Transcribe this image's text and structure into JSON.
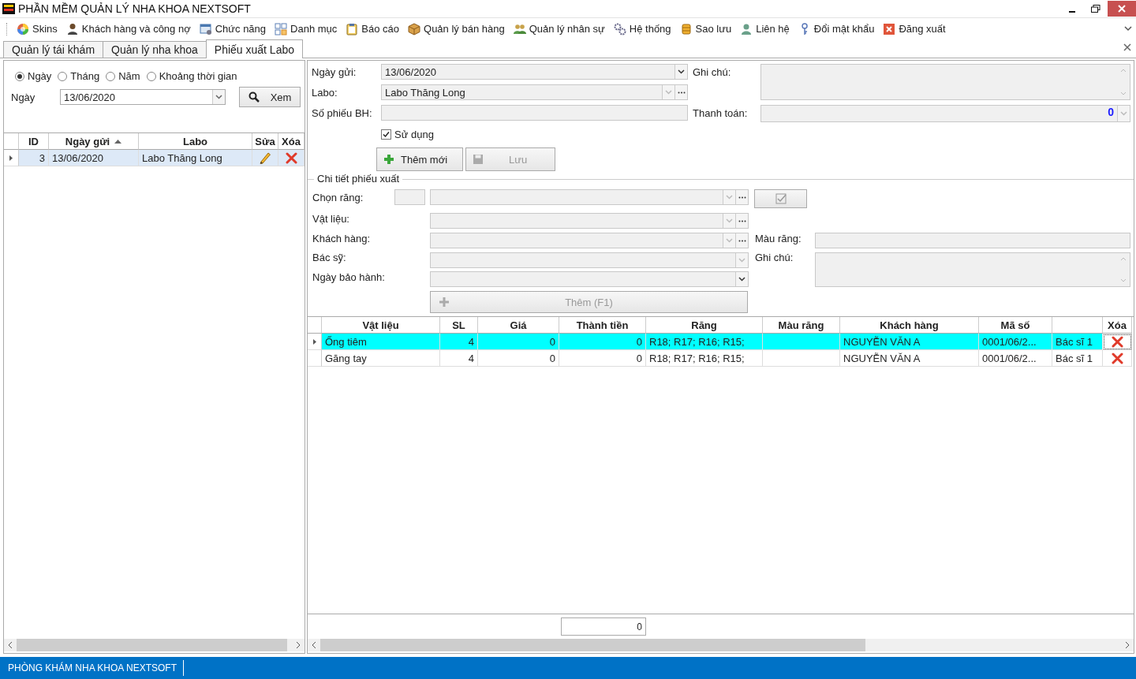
{
  "window": {
    "title": "PHẦN MỀM QUẢN LÝ NHA KHOA NEXTSOFT"
  },
  "menu": [
    {
      "label": "Skins"
    },
    {
      "label": "Khách hàng và công nợ"
    },
    {
      "label": "Chức năng"
    },
    {
      "label": "Danh mục"
    },
    {
      "label": "Báo cáo"
    },
    {
      "label": "Quản lý bán hàng"
    },
    {
      "label": "Quản lý nhân sự"
    },
    {
      "label": "Hệ thống"
    },
    {
      "label": "Sao lưu"
    },
    {
      "label": "Liên hệ"
    },
    {
      "label": "Đổi mật khẩu"
    },
    {
      "label": "Đăng xuất"
    }
  ],
  "tabs": [
    {
      "label": "Quản lý tái khám",
      "selected": false
    },
    {
      "label": "Quản lý nha khoa",
      "selected": false
    },
    {
      "label": "Phiếu xuất Labo",
      "selected": true
    }
  ],
  "filter": {
    "periods": [
      {
        "label": "Ngày",
        "selected": true
      },
      {
        "label": "Tháng",
        "selected": false
      },
      {
        "label": "Năm",
        "selected": false
      },
      {
        "label": "Khoảng thời gian",
        "selected": false
      }
    ],
    "date_label": "Ngày",
    "date_value": "13/06/2020",
    "view_button": "Xem"
  },
  "list_table": {
    "columns": [
      "ID",
      "Ngày gửi",
      "Labo",
      "Sửa",
      "Xóa"
    ],
    "rows": [
      {
        "id": "3",
        "date": "13/06/2020",
        "labo": "Labo Thăng Long",
        "selected": true
      }
    ]
  },
  "form": {
    "send_date": {
      "label": "Ngày gửi:",
      "value": "13/06/2020"
    },
    "labo": {
      "label": "Labo:",
      "value": "Labo Thăng Long"
    },
    "insurance_no": {
      "label": "Số phiếu BH:"
    },
    "note": {
      "label": "Ghi chú:"
    },
    "payment": {
      "label": "Thanh toán:",
      "value": "0"
    },
    "in_use": {
      "label": "Sử dụng",
      "checked": true
    },
    "buttons": [
      {
        "label": "Thêm mới",
        "disabled": false
      },
      {
        "label": "Lưu",
        "disabled": true
      }
    ]
  },
  "detail": {
    "title": "Chi tiết phiếu xuất",
    "fields": [
      {
        "label": "Chọn răng:"
      },
      {
        "label": "Vật liệu:"
      },
      {
        "label": "Khách hàng:"
      },
      {
        "label": "Bác sỹ:"
      },
      {
        "label": "Ngày bảo hành:"
      }
    ],
    "tooth_color": {
      "label": "Màu răng:"
    },
    "note": {
      "label": "Ghi chú:"
    },
    "add_button": {
      "label": "Thêm (F1)",
      "disabled": true
    }
  },
  "items_table": {
    "columns": [
      {
        "label": "Vật liệu"
      },
      {
        "label": "SL"
      },
      {
        "label": "Giá"
      },
      {
        "label": "Thành tiền"
      },
      {
        "label": "Răng"
      },
      {
        "label": "Màu răng"
      },
      {
        "label": "Khách hàng"
      },
      {
        "label": "Mã số"
      },
      {},
      {
        "label": "Xóa"
      }
    ],
    "rows": [
      {
        "selected": true,
        "cells": [
          "Ống tiêm",
          "4",
          "0",
          "0",
          "R18; R17; R16; R15;",
          "",
          "NGUYỄN VĂN A",
          "0001/06/2...",
          "Bác sĩ 1"
        ]
      },
      {
        "selected": false,
        "cells": [
          "Găng tay",
          "4",
          "0",
          "0",
          "R18; R17; R16; R15;",
          "",
          "NGUYỄN VĂN A",
          "0001/06/2...",
          "Bác sĩ 1"
        ]
      }
    ],
    "total": "0"
  },
  "status_bar": {
    "text": "PHÒNG KHÁM NHA KHOA NEXTSOFT"
  }
}
